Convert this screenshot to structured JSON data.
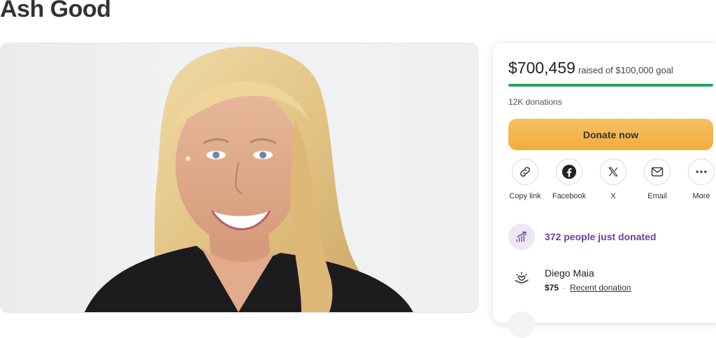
{
  "page": {
    "title": "Ash Good"
  },
  "fundraiser": {
    "amount_raised": "$700,459",
    "goal_text": "raised of $100,000 goal",
    "progress_fraction": 1.0,
    "donations_count": "12K donations",
    "donate_label": "Donate now"
  },
  "share": {
    "items": [
      {
        "label": "Copy link",
        "icon": "link-icon"
      },
      {
        "label": "Facebook",
        "icon": "facebook-icon"
      },
      {
        "label": "X",
        "icon": "x-logo-icon"
      },
      {
        "label": "Email",
        "icon": "email-icon"
      },
      {
        "label": "More",
        "icon": "more-icon"
      }
    ]
  },
  "activity": {
    "trend_text": "372 people just donated",
    "recent": {
      "name": "Diego Maia",
      "amount": "$75",
      "separator": "·",
      "label": "Recent donation"
    }
  },
  "colors": {
    "progress": "#22a35a",
    "donate_button": "#f2ab3e",
    "trend_text": "#6b3fa0"
  }
}
